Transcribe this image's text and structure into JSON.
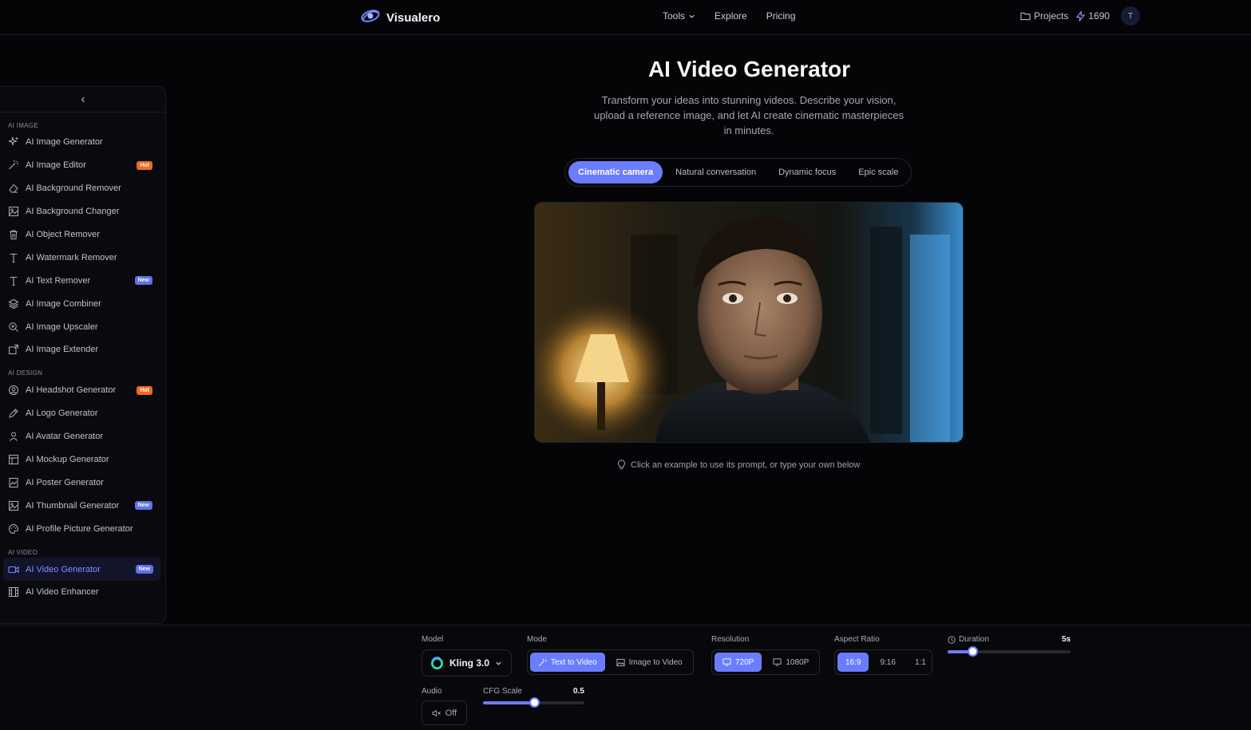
{
  "brand": {
    "name": "Visualero"
  },
  "nav": {
    "tools": "Tools",
    "explore": "Explore",
    "pricing": "Pricing"
  },
  "account": {
    "projects": "Projects",
    "credits": "1690",
    "avatar_initial": "T"
  },
  "sidebar": {
    "sections": [
      {
        "label": "AI IMAGE",
        "items": [
          {
            "label": "AI Image Generator",
            "icon": "sparkles-icon"
          },
          {
            "label": "AI Image Editor",
            "icon": "magic-wand-icon",
            "badge": "Hot"
          },
          {
            "label": "AI Background Remover",
            "icon": "eraser-icon"
          },
          {
            "label": "AI Background Changer",
            "icon": "image-icon"
          },
          {
            "label": "AI Object Remover",
            "icon": "trash-icon"
          },
          {
            "label": "AI Watermark Remover",
            "icon": "text-icon"
          },
          {
            "label": "AI Text Remover",
            "icon": "text-icon",
            "badge": "New"
          },
          {
            "label": "AI Image Combiner",
            "icon": "layers-icon"
          },
          {
            "label": "AI Image Upscaler",
            "icon": "zoom-icon"
          },
          {
            "label": "AI Image Extender",
            "icon": "expand-image-icon"
          }
        ]
      },
      {
        "label": "AI DESIGN",
        "items": [
          {
            "label": "AI Headshot Generator",
            "icon": "user-circle-icon",
            "badge": "Hot"
          },
          {
            "label": "AI Logo Generator",
            "icon": "pen-icon"
          },
          {
            "label": "AI Avatar Generator",
            "icon": "user-icon"
          },
          {
            "label": "AI Mockup Generator",
            "icon": "layout-icon"
          },
          {
            "label": "AI Poster Generator",
            "icon": "poster-icon"
          },
          {
            "label": "AI Thumbnail Generator",
            "icon": "image-icon",
            "badge": "New"
          },
          {
            "label": "AI Profile Picture Generator",
            "icon": "palette-icon"
          }
        ]
      },
      {
        "label": "AI VIDEO",
        "items": [
          {
            "label": "AI Video Generator",
            "icon": "video-icon",
            "badge": "New",
            "active": true
          },
          {
            "label": "AI Video Enhancer",
            "icon": "film-icon"
          }
        ]
      }
    ]
  },
  "main": {
    "title": "AI Video Generator",
    "subtitle": "Transform your ideas into stunning videos. Describe your vision, upload a reference image, and let AI create cinematic masterpieces in minutes.",
    "tabs": [
      "Cinematic camera",
      "Natural conversation",
      "Dynamic focus",
      "Epic scale"
    ],
    "active_tab": 0,
    "hint": "Click an example to use its prompt, or type your own below"
  },
  "controls": {
    "model": {
      "label": "Model",
      "value": "Kling 3.0"
    },
    "mode": {
      "label": "Mode",
      "options": [
        "Text to Video",
        "Image to Video"
      ],
      "selected": 0
    },
    "resolution": {
      "label": "Resolution",
      "options": [
        "720P",
        "1080P"
      ],
      "selected": 0
    },
    "aspect": {
      "label": "Aspect Ratio",
      "options": [
        "16:9",
        "9:16",
        "1:1"
      ],
      "selected": 0
    },
    "duration": {
      "label": "Duration",
      "value": "5s",
      "fill_fraction": 0.2
    },
    "audio": {
      "label": "Audio",
      "value": "Off"
    },
    "cfg": {
      "label": "CFG Scale",
      "value": "0.5",
      "fill_fraction": 0.5
    }
  },
  "colors": {
    "accent": "#6a7dff",
    "hot": "#f06a1f",
    "new": "#5f6ff0",
    "background": "#050508"
  }
}
